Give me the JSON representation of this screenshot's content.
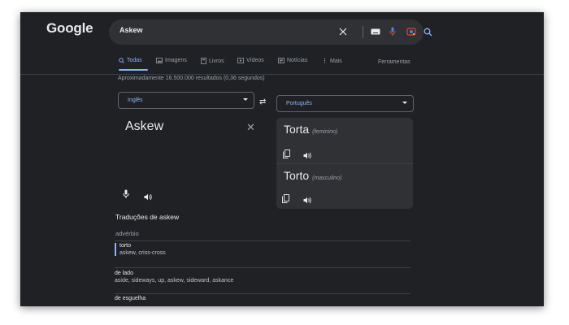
{
  "header": {
    "logo_text": "Google"
  },
  "search": {
    "query": "Askew",
    "icons": [
      "close-icon",
      "keyboard-icon",
      "microphone-icon",
      "lens-icon",
      "search-icon"
    ]
  },
  "tabs": [
    {
      "label": "Todas",
      "icon": "search-icon",
      "active": true
    },
    {
      "label": "Imagens",
      "icon": "image-icon",
      "active": false
    },
    {
      "label": "Livros",
      "icon": "book-icon",
      "active": false
    },
    {
      "label": "Vídeos",
      "icon": "play-icon",
      "active": false
    },
    {
      "label": "Notícias",
      "icon": "news-icon",
      "active": false
    },
    {
      "label": "Mais",
      "icon": "more-vert-icon",
      "active": false
    }
  ],
  "tools_label": "Ferramentas",
  "stats": "Aproximadamente 16.500.000 resultados (0,36 segundos)",
  "translator": {
    "source_lang": "Inglês",
    "target_lang": "Português",
    "source_text": "Askew",
    "results": [
      {
        "word": "Torta",
        "gender": "(feminino)"
      },
      {
        "word": "Torto",
        "gender": "(masculino)"
      }
    ]
  },
  "translations": {
    "title": "Traduções de askew",
    "pos": "advérbio",
    "entries": [
      {
        "word": "torto",
        "synonyms": "askew, criss-cross"
      },
      {
        "word": "de lado",
        "synonyms": "aside, sideways, up, askew, sideward, askance"
      },
      {
        "word": "de esguelha",
        "synonyms": ""
      }
    ]
  },
  "colors": {
    "background": "#202124",
    "panel": "#303134",
    "accent": "#8ab4f8",
    "text": "#e8eaed",
    "muted": "#9aa0a6"
  }
}
